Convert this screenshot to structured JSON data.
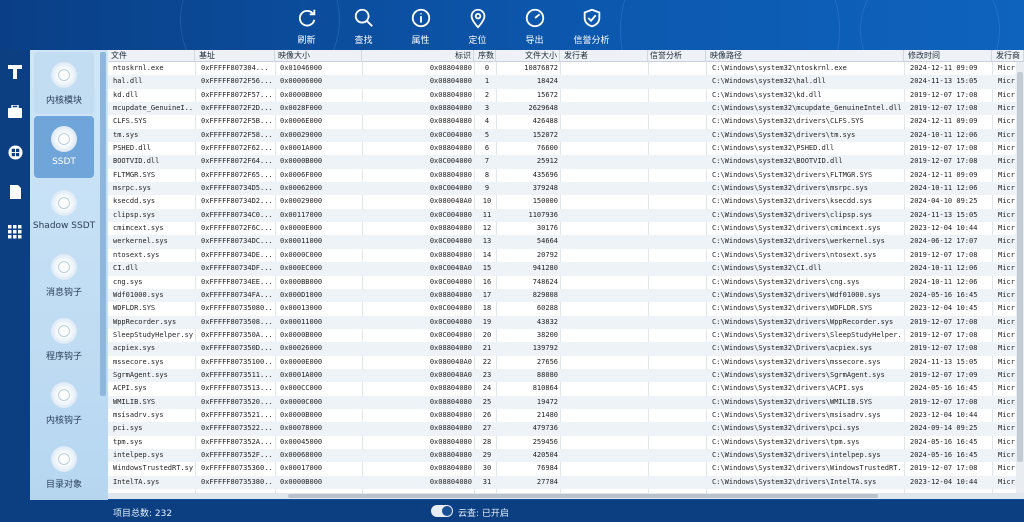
{
  "colors": {
    "accent": "#0c57ad",
    "sidebar_active": "#6fa5d9",
    "status_bar": "#0c3f81"
  },
  "toolbar": [
    {
      "label": "刷新",
      "icon": "refresh-icon"
    },
    {
      "label": "查找",
      "icon": "search-icon"
    },
    {
      "label": "属性",
      "icon": "info-icon"
    },
    {
      "label": "定位",
      "icon": "location-pin-icon"
    },
    {
      "label": "导出",
      "icon": "gauge-export-icon"
    },
    {
      "label": "信誉分析",
      "icon": "shield-check-icon"
    }
  ],
  "left_nav": [
    "logo-t-icon",
    "toolbox-icon",
    "windows-icon",
    "document-icon",
    "grid-icon"
  ],
  "sidebar": [
    {
      "label": "内核模块",
      "active": false
    },
    {
      "label": "SSDT",
      "active": true
    },
    {
      "label": "Shadow SSDT",
      "active": false
    },
    {
      "label": "消息钩子",
      "active": false
    },
    {
      "label": "程序钩子",
      "active": false
    },
    {
      "label": "内核钩子",
      "active": false
    },
    {
      "label": "目录对象",
      "active": false
    }
  ],
  "table": {
    "columns": [
      "文件",
      "基址",
      "映像大小",
      "标识",
      "序数",
      "文件大小",
      "发行者",
      "信誉分析",
      "映像路径",
      "修改时间",
      "发行商"
    ],
    "rows": [
      [
        "ntoskrnl.exe",
        "0xFFFFF807304...",
        "0x01046000",
        "0x08804080",
        "0",
        "10876872",
        "",
        "",
        "C:\\Windows\\system32\\ntoskrnl.exe",
        "2024-12-11 09:09",
        "Micr"
      ],
      [
        "hal.dll",
        "0xFFFFF8072F56...",
        "0x00006000",
        "0x08804080",
        "1",
        "18424",
        "",
        "",
        "C:\\Windows\\system32\\hal.dll",
        "2024-11-13 15:05",
        "Micr"
      ],
      [
        "kd.dll",
        "0xFFFFF8072F57...",
        "0x0000B000",
        "0x08804080",
        "2",
        "15672",
        "",
        "",
        "C:\\Windows\\system32\\kd.dll",
        "2019-12-07 17:08",
        "Micr"
      ],
      [
        "mcupdate_GenuineI...",
        "0xFFFFF8072F2D...",
        "0x0028F000",
        "0x08804080",
        "3",
        "2629648",
        "",
        "",
        "C:\\Windows\\system32\\mcupdate_GenuineIntel.dll",
        "2019-12-07 17:08",
        "Micr"
      ],
      [
        "CLFS.SYS",
        "0xFFFFF8072F5B...",
        "0x0006E000",
        "0x08804080",
        "4",
        "426488",
        "",
        "",
        "C:\\Windows\\System32\\drivers\\CLFS.SYS",
        "2024-12-11 09:09",
        "Micr"
      ],
      [
        "tm.sys",
        "0xFFFFF8072F58...",
        "0x00029000",
        "0x0C004080",
        "5",
        "152072",
        "",
        "",
        "C:\\Windows\\System32\\drivers\\tm.sys",
        "2024-10-11 12:06",
        "Micr"
      ],
      [
        "PSHED.dll",
        "0xFFFFF8072F62...",
        "0x0001A000",
        "0x08804080",
        "6",
        "76600",
        "",
        "",
        "C:\\Windows\\system32\\PSHED.dll",
        "2019-12-07 17:08",
        "Micr"
      ],
      [
        "BOOTVID.dll",
        "0xFFFFF8072F64...",
        "0x0000B000",
        "0x0C004000",
        "7",
        "25912",
        "",
        "",
        "C:\\Windows\\system32\\BOOTVID.dll",
        "2019-12-07 17:08",
        "Micr"
      ],
      [
        "FLTMGR.SYS",
        "0xFFFFF8072F65...",
        "0x0006F000",
        "0x08804080",
        "8",
        "435696",
        "",
        "",
        "C:\\Windows\\System32\\drivers\\FLTMGR.SYS",
        "2024-12-11 09:09",
        "Micr"
      ],
      [
        "msrpc.sys",
        "0xFFFFF80734D5...",
        "0x00062000",
        "0x0C004080",
        "9",
        "379248",
        "",
        "",
        "C:\\Windows\\System32\\drivers\\msrpc.sys",
        "2024-10-11 12:06",
        "Micr"
      ],
      [
        "ksecdd.sys",
        "0xFFFFF80734D2...",
        "0x00029000",
        "0x080040A0",
        "10",
        "150000",
        "",
        "",
        "C:\\Windows\\System32\\drivers\\ksecdd.sys",
        "2024-04-10 09:25",
        "Micr"
      ],
      [
        "clipsp.sys",
        "0xFFFFF80734C0...",
        "0x00117000",
        "0x0C004080",
        "11",
        "1107936",
        "",
        "",
        "C:\\Windows\\System32\\drivers\\clipsp.sys",
        "2024-11-13 15:05",
        "Micr"
      ],
      [
        "cmimcext.sys",
        "0xFFFFF8072F6C...",
        "0x0000E000",
        "0x08804080",
        "12",
        "30176",
        "",
        "",
        "C:\\Windows\\System32\\drivers\\cmimcext.sys",
        "2023-12-04 10:44",
        "Micr"
      ],
      [
        "werkernel.sys",
        "0xFFFFF80734DC...",
        "0x00011000",
        "0x0C004080",
        "13",
        "54664",
        "",
        "",
        "C:\\Windows\\System32\\drivers\\werkernel.sys",
        "2024-06-12 17:07",
        "Micr"
      ],
      [
        "ntosext.sys",
        "0xFFFFF80734DE...",
        "0x0000C000",
        "0x08804080",
        "14",
        "20792",
        "",
        "",
        "C:\\Windows\\System32\\drivers\\ntosext.sys",
        "2019-12-07 17:08",
        "Micr"
      ],
      [
        "CI.dll",
        "0xFFFFF80734DF...",
        "0x000EC000",
        "0x0C0040A0",
        "15",
        "941280",
        "",
        "",
        "C:\\Windows\\System32\\CI.dll",
        "2024-10-11 12:06",
        "Micr"
      ],
      [
        "cng.sys",
        "0xFFFFF80734EE...",
        "0x000BB000",
        "0x0C004080",
        "16",
        "748624",
        "",
        "",
        "C:\\Windows\\System32\\drivers\\cng.sys",
        "2024-10-11 12:06",
        "Micr"
      ],
      [
        "Wdf01000.sys",
        "0xFFFFF80734FA...",
        "0x000D1000",
        "0x08804080",
        "17",
        "829808",
        "",
        "",
        "C:\\Windows\\System32\\drivers\\Wdf01000.sys",
        "2024-05-16 16:45",
        "Micr"
      ],
      [
        "WDFLDR.SYS",
        "0xFFFFF80735080...",
        "0x00013000",
        "0x0C004080",
        "18",
        "60288",
        "",
        "",
        "C:\\Windows\\System32\\drivers\\WDFLDR.SYS",
        "2023-12-04 10:45",
        "Micr"
      ],
      [
        "WppRecorder.sys",
        "0xFFFFF8073508...",
        "0x00011000",
        "0x0C004080",
        "19",
        "43832",
        "",
        "",
        "C:\\Windows\\System32\\drivers\\WppRecorder.sys",
        "2019-12-07 17:08",
        "Micr"
      ],
      [
        "SleepStudyHelper.sys",
        "0xFFFFF807350A...",
        "0x0000B000",
        "0x0C004080",
        "20",
        "38200",
        "",
        "",
        "C:\\Windows\\System32\\drivers\\SleepStudyHelper.sys",
        "2019-12-07 17:08",
        "Micr"
      ],
      [
        "acpiex.sys",
        "0xFFFFF807350D...",
        "0x00026000",
        "0x08804080",
        "21",
        "139792",
        "",
        "",
        "C:\\Windows\\System32\\Drivers\\acpiex.sys",
        "2019-12-07 17:08",
        "Micr"
      ],
      [
        "mssecore.sys",
        "0xFFFFF80735100...",
        "0x0000E000",
        "0x080040A0",
        "22",
        "27656",
        "",
        "",
        "C:\\Windows\\system32\\drivers\\mssecore.sys",
        "2024-11-13 15:05",
        "Micr"
      ],
      [
        "SgrmAgent.sys",
        "0xFFFFF8073511...",
        "0x0001A000",
        "0x080040A0",
        "23",
        "88080",
        "",
        "",
        "C:\\Windows\\system32\\drivers\\SgrmAgent.sys",
        "2019-12-07 17:09",
        "Micr"
      ],
      [
        "ACPI.sys",
        "0xFFFFF8073513...",
        "0x000CC000",
        "0x08804080",
        "24",
        "810864",
        "",
        "",
        "C:\\Windows\\System32\\drivers\\ACPI.sys",
        "2024-05-16 16:45",
        "Micr"
      ],
      [
        "WMILIB.SYS",
        "0xFFFFF8073520...",
        "0x0000C000",
        "0x08804080",
        "25",
        "19472",
        "",
        "",
        "C:\\Windows\\System32\\drivers\\WMILIB.SYS",
        "2019-12-07 17:08",
        "Micr"
      ],
      [
        "msisadrv.sys",
        "0xFFFFF8073521...",
        "0x0000B000",
        "0x08804080",
        "26",
        "21480",
        "",
        "",
        "C:\\Windows\\System32\\drivers\\msisadrv.sys",
        "2023-12-04 10:44",
        "Micr"
      ],
      [
        "pci.sys",
        "0xFFFFF8073522...",
        "0x00078000",
        "0x08804080",
        "27",
        "479736",
        "",
        "",
        "C:\\Windows\\System32\\drivers\\pci.sys",
        "2024-09-14 09:25",
        "Micr"
      ],
      [
        "tpm.sys",
        "0xFFFFF807352A...",
        "0x00045000",
        "0x08804080",
        "28",
        "259456",
        "",
        "",
        "C:\\Windows\\System32\\drivers\\tpm.sys",
        "2024-05-16 16:45",
        "Micr"
      ],
      [
        "intelpep.sys",
        "0xFFFFF807352F...",
        "0x00068000",
        "0x08804080",
        "29",
        "420504",
        "",
        "",
        "C:\\Windows\\System32\\drivers\\intelpep.sys",
        "2024-05-16 16:45",
        "Micr"
      ],
      [
        "WindowsTrustedRT.sys",
        "0xFFFFF80735360...",
        "0x00017000",
        "0x08804080",
        "30",
        "76984",
        "",
        "",
        "C:\\Windows\\System32\\drivers\\WindowsTrustedRT.sys",
        "2019-12-07 17:08",
        "Micr"
      ],
      [
        "IntelTA.sys",
        "0xFFFFF80735380...",
        "0x0000B000",
        "0x08804080",
        "31",
        "27784",
        "",
        "",
        "C:\\Windows\\System32\\drivers\\IntelTA.sys",
        "2023-12-04 10:44",
        "Micr"
      ]
    ]
  },
  "status": {
    "total": "项目总数: 232",
    "cloud": "云查: 已开启"
  }
}
